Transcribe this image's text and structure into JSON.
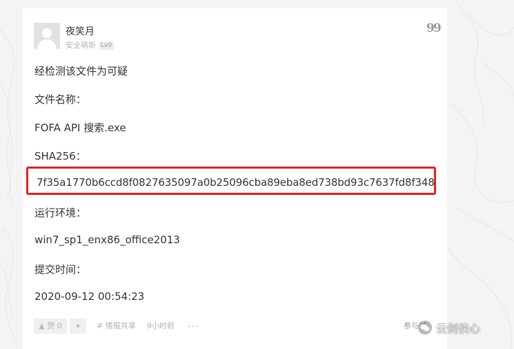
{
  "post": {
    "username": "夜笑月",
    "role": "安全萌新",
    "level": "Lv0",
    "quote_icon": "quote-icon",
    "lines": [
      "经检测该文件为可疑",
      "文件名称：",
      "FOFA API 搜索.exe",
      "SHA256：",
      "7f35a1770b6ccd8f0827635097a0b25096cba89eba8ed738bd93c7637fd8f348",
      "运行环境：",
      "win7_sp1_enx86_office2013",
      "提交时间：",
      "2020-09-12 00:54:23"
    ],
    "highlight_color": "#e02020"
  },
  "footer": {
    "like_label": "赞",
    "like_count": "0",
    "tag_label": "情报共享",
    "time_label": "9小时前",
    "more_label": "···",
    "participate_label": "参与讨"
  },
  "watermark": {
    "text": "云剑侠心"
  }
}
